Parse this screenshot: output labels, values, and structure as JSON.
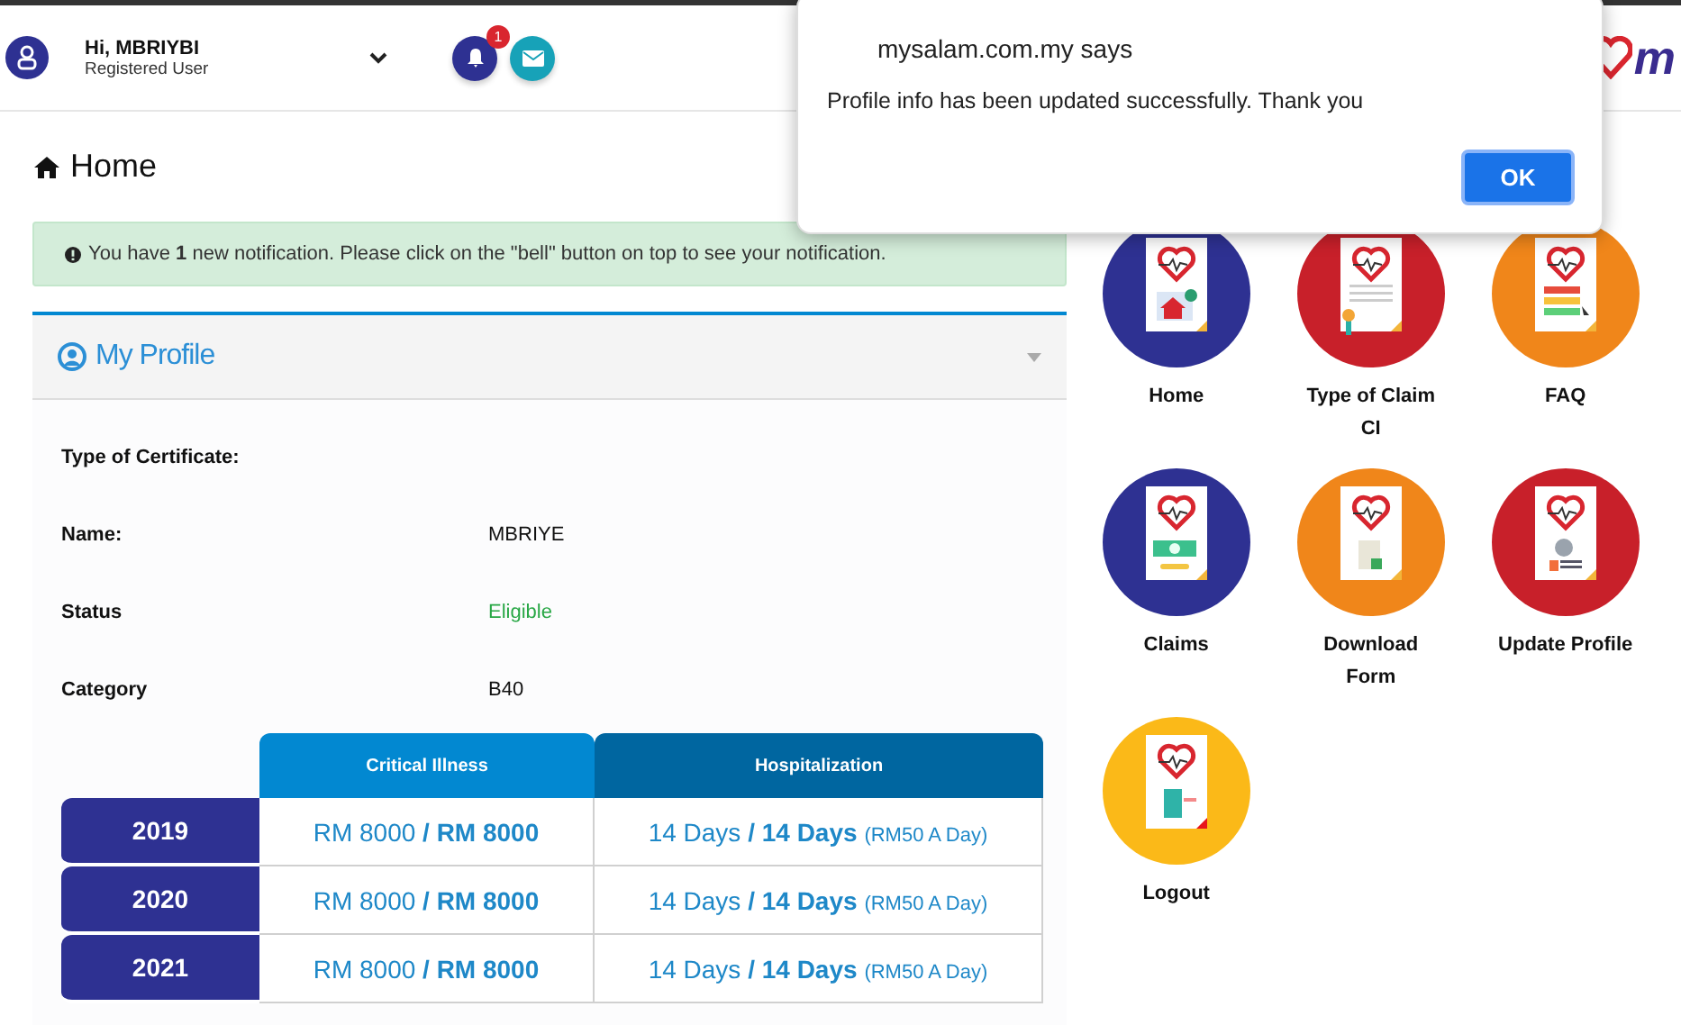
{
  "header": {
    "greeting": "Hi, MBRIYBI",
    "role": "Registered User",
    "notification_count": "1",
    "logo_text": "m"
  },
  "dialog": {
    "title": "mysalam.com.my says",
    "message": "Profile info has been updated successfully. Thank you",
    "button": "OK"
  },
  "page_title": "Home",
  "alert": "You have **1** new notification. Please click on the \"bell\" button on top to see your notification.",
  "profile": {
    "title": "My Profile",
    "fields": [
      {
        "label": "Type of Certificate:",
        "kind": "plain"
      },
      {
        "label": "Name:",
        "value": "MBRIYE",
        "kind": "plain"
      },
      {
        "label": "Status",
        "value": "Eligible",
        "kind": "status"
      },
      {
        "label": "Category",
        "value": "B40",
        "kind": "plain"
      }
    ],
    "table": {
      "columns": [
        "Critical Illness",
        "Hospitalization"
      ],
      "rows": [
        {
          "year": "2019",
          "critical_illness": "RM 8000 **/ RM 8000**",
          "hospitalization": "14 Days **/ 14 Days**",
          "hospitalization_rate": "(RM50 A Day)"
        },
        {
          "year": "2020",
          "critical_illness": "RM 8000 **/ RM 8000**",
          "hospitalization": "14 Days **/ 14 Days**",
          "hospitalization_rate": "(RM50 A Day)"
        },
        {
          "year": "2021",
          "critical_illness": "RM 8000 **/ RM 8000**",
          "hospitalization": "14 Days **/ 14 Days**",
          "hospitalization_rate": "(RM50 A Day)"
        }
      ]
    }
  },
  "menu": [
    {
      "label": "Home",
      "kind": "house",
      "color": "#2e3192"
    },
    {
      "label": "Type of Claim CI",
      "kind": "certificate",
      "color": "#c8202a"
    },
    {
      "label": "FAQ",
      "kind": "list",
      "color": "#f0861a"
    },
    {
      "label": "Claims",
      "kind": "money",
      "color": "#2e3192"
    },
    {
      "label": "Download Form",
      "kind": "download",
      "color": "#f0861a"
    },
    {
      "label": "Update Profile",
      "kind": "profile",
      "color": "#c8202a"
    },
    {
      "label": "Logout",
      "kind": "door",
      "color": "#fbb918"
    }
  ]
}
